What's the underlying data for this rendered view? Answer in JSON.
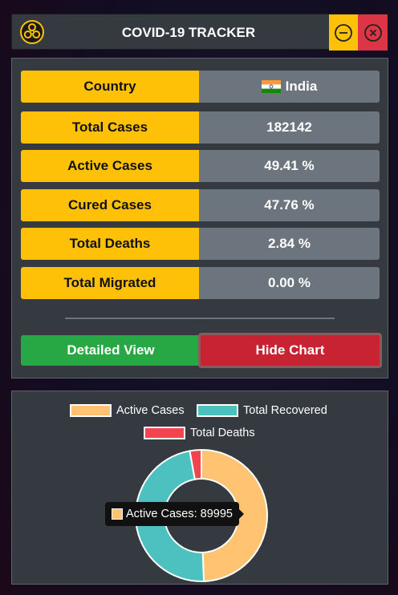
{
  "window": {
    "title": "COVID-19 TRACKER",
    "logo_icon": "biohazard-icon",
    "minimize_icon": "minimize-icon",
    "close_icon": "close-icon"
  },
  "stats": [
    {
      "key": "country",
      "label": "Country",
      "value": "India",
      "flag_icon": "india-flag-icon"
    },
    {
      "key": "total-cases",
      "label": "Total Cases",
      "value": "182142"
    },
    {
      "key": "active-cases",
      "label": "Active Cases",
      "value": "49.41 %"
    },
    {
      "key": "cured-cases",
      "label": "Cured Cases",
      "value": "47.76 %"
    },
    {
      "key": "total-deaths",
      "label": "Total Deaths",
      "value": "2.84 %"
    },
    {
      "key": "total-migrated",
      "label": "Total Migrated",
      "value": "0.00 %"
    }
  ],
  "buttons": {
    "detailed_view": "Detailed View",
    "hide_chart": "Hide Chart"
  },
  "colors": {
    "label_bg": "#ffc107",
    "value_bg": "#6c757d",
    "detail_btn": "#28a745",
    "hide_btn": "#c82333"
  },
  "chart_data": {
    "type": "doughnut",
    "title": "",
    "legend_position": "top",
    "series": [
      {
        "name": "Active Cases",
        "value": 89995,
        "color": "#ffc372"
      },
      {
        "name": "Total Recovered",
        "value": 86984,
        "color": "#4cc1bf"
      },
      {
        "name": "Total Deaths",
        "value": 5164,
        "color": "#f2444f"
      }
    ],
    "tooltip": {
      "label": "Active Cases",
      "value": 89995,
      "text": "Active Cases: 89995"
    }
  }
}
